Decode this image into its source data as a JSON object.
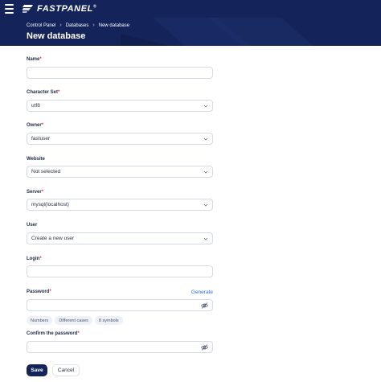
{
  "app": {
    "logo_text": "FASTPANEL",
    "logo_mark": "®"
  },
  "breadcrumb": {
    "items": [
      "Control Panel",
      "Databases",
      "New database"
    ],
    "separator": "›"
  },
  "page": {
    "title": "New database"
  },
  "form": {
    "name": {
      "label": "Name",
      "required_mark": "*",
      "value": ""
    },
    "charset": {
      "label": "Character Set",
      "required_mark": "*",
      "value": "utf8"
    },
    "owner": {
      "label": "Owner",
      "required_mark": "*",
      "value": "fastuser"
    },
    "website": {
      "label": "Website",
      "value": "Not selected"
    },
    "server": {
      "label": "Server",
      "required_mark": "*",
      "value": "mysql(localhost)"
    },
    "user": {
      "label": "User",
      "value": "Create a new user"
    },
    "login": {
      "label": "Login",
      "required_mark": "*",
      "value": ""
    },
    "password": {
      "label": "Password",
      "required_mark": "*",
      "value": "",
      "generate_label": "Generate"
    },
    "password_hints": [
      "Numbers",
      "Different cases",
      "8 symbols"
    ],
    "confirm_password": {
      "label": "Confirm the password",
      "required_mark": "*",
      "value": ""
    }
  },
  "actions": {
    "save_label": "Save",
    "cancel_label": "Cancel"
  },
  "colors": {
    "header_bg": "#14245a",
    "required": "#e5334b",
    "link": "#2f6ee0"
  },
  "icons": {
    "menu": "hamburger-icon",
    "select": "chevron-down-icon",
    "password_toggle": "eye-slash-icon"
  }
}
